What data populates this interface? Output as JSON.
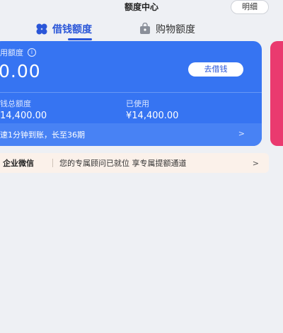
{
  "header": {
    "title": "额度中心",
    "detail_button": "明细"
  },
  "tabs": [
    {
      "label": "借钱额度",
      "active": true,
      "icon": "four-leaf-icon"
    },
    {
      "label": "购物额度",
      "active": false,
      "icon": "shopping-bag-icon"
    }
  ],
  "credit_card": {
    "available_label": "用额度",
    "available_amount": "0.00",
    "borrow_button": "去借钱",
    "total_label": "钱总额度",
    "total_value": "14,400.00",
    "used_label": "已使用",
    "used_value": "¥14,400.00",
    "promo_text": "速1分钟到账，长至36期",
    "chevron": ">"
  },
  "wecom_bar": {
    "name": "企业微信",
    "text": "您的专属顾问已就位 享专属提额通道",
    "chevron": ">"
  },
  "colors": {
    "accent": "#2a56d8",
    "card": "#3674f2",
    "side_card": "#ea3a6f",
    "background": "#eef0f4"
  }
}
